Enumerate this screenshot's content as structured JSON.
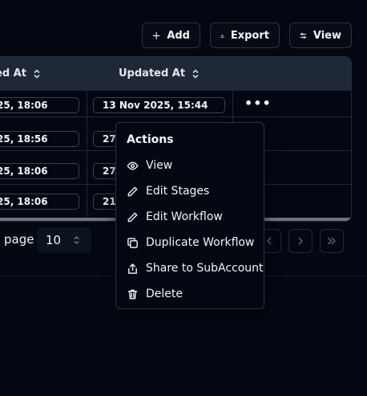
{
  "toolbar": {
    "add_label": "Add",
    "export_label": "Export",
    "view_label": "View"
  },
  "table": {
    "columns": [
      "ed At",
      "Updated At"
    ],
    "rows": [
      {
        "created": "25, 18:06",
        "updated": "13 Nov 2025, 15:44"
      },
      {
        "created": "25, 18:56",
        "updated": "27"
      },
      {
        "created": "25, 18:06",
        "updated": "27"
      },
      {
        "created": "25, 18:06",
        "updated": "21"
      }
    ],
    "row_actions": "•••"
  },
  "pagination": {
    "label": "page",
    "page_size": "10"
  },
  "actions_menu": {
    "title": "Actions",
    "items": [
      {
        "label": "View",
        "icon": "eye-icon"
      },
      {
        "label": "Edit Stages",
        "icon": "pencil-icon"
      },
      {
        "label": "Edit Workflow",
        "icon": "pencil-icon"
      },
      {
        "label": "Duplicate Workflow",
        "icon": "copy-icon"
      },
      {
        "label": "Share to SubAccount",
        "icon": "share-icon"
      },
      {
        "label": "Delete",
        "icon": "trash-icon"
      }
    ]
  }
}
